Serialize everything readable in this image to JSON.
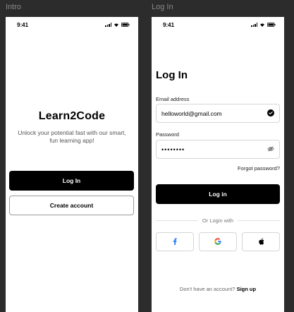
{
  "frames": {
    "intro_label": "Intro",
    "login_label": "Log In"
  },
  "status_bar": {
    "time": "9:41"
  },
  "intro": {
    "title": "Learn2Code",
    "subtitle": "Unlock your potential fast with our smart, fun learning app!",
    "login_button": "Log In",
    "create_account_button": "Create account"
  },
  "login": {
    "heading": "Log In",
    "email_label": "Email address",
    "email_value": "helloworld@gmail.com",
    "password_label": "Password",
    "password_value": "••••••••",
    "forgot_password": "Forgot password?",
    "login_button": "Log in",
    "divider_text": "Or Login with",
    "signup_prompt": "Don't have an account?",
    "signup_link": "Sign up"
  },
  "icons": {
    "email_valid": "check-circle-icon",
    "password_toggle": "eye-off-icon",
    "social": [
      "facebook-icon",
      "google-icon",
      "apple-icon"
    ]
  },
  "colors": {
    "primary": "#000000",
    "facebook": "#1877F2",
    "google_blue": "#4285F4",
    "google_red": "#EA4335",
    "google_yellow": "#FBBC05",
    "google_green": "#34A853"
  }
}
